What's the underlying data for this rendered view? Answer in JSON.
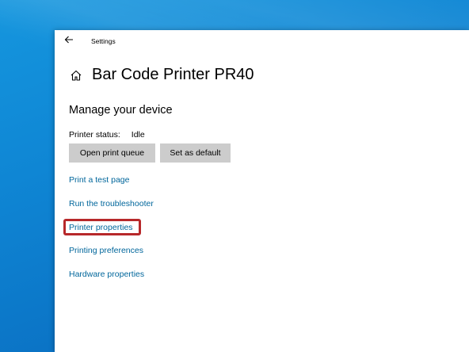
{
  "window": {
    "title": "Settings"
  },
  "header": {
    "page_title": "Bar Code Printer PR40"
  },
  "section": {
    "title": "Manage your device"
  },
  "status": {
    "label": "Printer status:",
    "value": "Idle"
  },
  "buttons": {
    "open_queue": "Open print queue",
    "set_default": "Set as default"
  },
  "links": {
    "test_page": "Print a test page",
    "troubleshooter": "Run the troubleshooter",
    "printer_properties": "Printer properties",
    "printing_preferences": "Printing preferences",
    "hardware_properties": "Hardware properties"
  },
  "colors": {
    "link": "#00669b",
    "button_bg": "#cccccc",
    "highlight_border": "#b7282a",
    "desktop": "#0f86d4"
  },
  "icons": {
    "back": "back-arrow-icon",
    "home": "home-icon"
  }
}
